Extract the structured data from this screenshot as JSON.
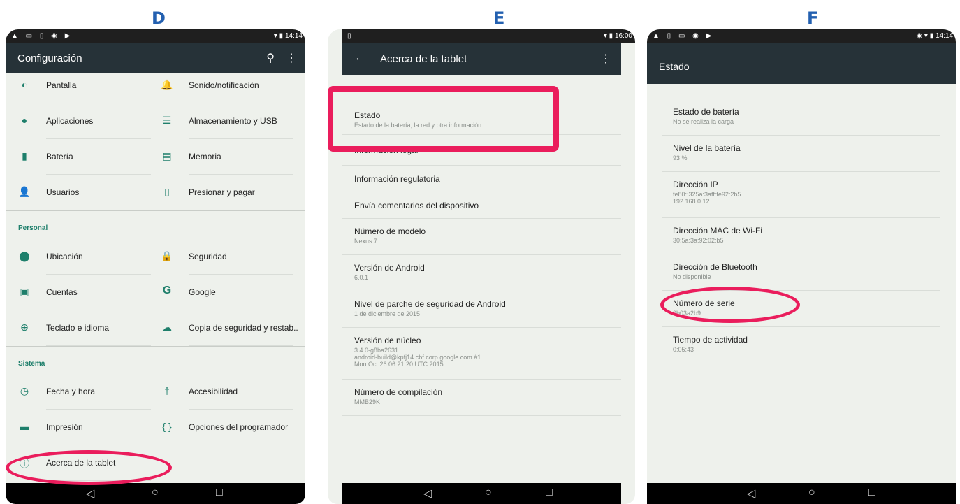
{
  "panels": {
    "d": {
      "letter": "D",
      "status_time": "14:14",
      "title": "Configuración",
      "rows_top": [
        {
          "left": {
            "icon": "brightness-icon",
            "glyph": "◐",
            "label": "Pantalla"
          },
          "right": {
            "icon": "bell-icon",
            "glyph": "🔔",
            "label": "Sonido/notificación"
          }
        },
        {
          "left": {
            "icon": "android-icon",
            "glyph": "●",
            "label": "Aplicaciones"
          },
          "right": {
            "icon": "storage-icon",
            "glyph": "☰",
            "label": "Almacenamiento y USB"
          }
        },
        {
          "left": {
            "icon": "battery-icon",
            "glyph": "▮",
            "label": "Batería"
          },
          "right": {
            "icon": "memory-icon",
            "glyph": "▤",
            "label": "Memoria"
          }
        },
        {
          "left": {
            "icon": "user-icon",
            "glyph": "👤",
            "label": "Usuarios"
          },
          "right": {
            "icon": "tap-pay-icon",
            "glyph": "▯",
            "label": "Presionar y pagar"
          }
        }
      ],
      "section_personal": "Personal",
      "rows_personal": [
        {
          "left": {
            "icon": "location-icon",
            "glyph": "⬤",
            "label": "Ubicación"
          },
          "right": {
            "icon": "lock-icon",
            "glyph": "🔒",
            "label": "Seguridad"
          }
        },
        {
          "left": {
            "icon": "account-icon",
            "glyph": "▣",
            "label": "Cuentas"
          },
          "right": {
            "icon": "google-icon",
            "glyph": "G",
            "label": "Google"
          }
        },
        {
          "left": {
            "icon": "globe-icon",
            "glyph": "⊕",
            "label": "Teclado e idioma"
          },
          "right": {
            "icon": "cloud-upload-icon",
            "glyph": "☁",
            "label": "Copia de seguridad y restab.."
          }
        }
      ],
      "section_system": "Sistema",
      "rows_system": [
        {
          "left": {
            "icon": "clock-icon",
            "glyph": "◷",
            "label": "Fecha y hora"
          },
          "right": {
            "icon": "accessibility-icon",
            "glyph": "†",
            "label": "Accesibilidad"
          }
        },
        {
          "left": {
            "icon": "print-icon",
            "glyph": "▬",
            "label": "Impresión"
          },
          "right": {
            "icon": "code-braces-icon",
            "glyph": "{ }",
            "label": "Opciones del programador"
          }
        },
        {
          "left": {
            "icon": "info-icon",
            "glyph": "ⓘ",
            "label": "Acerca de la tablet"
          }
        }
      ]
    },
    "e": {
      "letter": "E",
      "status_time": "16:00",
      "title": "Acerca de la tablet",
      "items": [
        {
          "title": "Estado",
          "subtitle": "Estado de la batería, la red y otra información"
        },
        {
          "title": "Información legal",
          "subtitle": ""
        },
        {
          "title": "Información regulatoria",
          "subtitle": ""
        },
        {
          "title": "Envía comentarios del dispositivo",
          "subtitle": ""
        },
        {
          "title": "Número de modelo",
          "subtitle": "Nexus 7"
        },
        {
          "title": "Versión de Android",
          "subtitle": "6.0.1"
        },
        {
          "title": "Nivel de parche de seguridad de Android",
          "subtitle": "1 de diciembre de 2015"
        },
        {
          "title": "Versión de núcleo",
          "subtitle": "3.4.0-g8ba2631\nandroid-build@kpfj14.cbf.corp.google.com #1\nMon Oct 26 06:21:20 UTC 2015"
        },
        {
          "title": "Número de compilación",
          "subtitle": "MMB29K"
        }
      ]
    },
    "f": {
      "letter": "F",
      "status_time": "14:14",
      "title": "Estado",
      "items": [
        {
          "title": "Estado de batería",
          "subtitle": "No se realiza la carga"
        },
        {
          "title": "Nivel de la batería",
          "subtitle": "93 %"
        },
        {
          "title": "Dirección IP",
          "subtitle": "fe80::325a:3aff:fe92:2b5\n192.168.0.12"
        },
        {
          "title": "Dirección MAC de Wi-Fi",
          "subtitle": "30:5a:3a:92:02:b5"
        },
        {
          "title": "Dirección de Bluetooth",
          "subtitle": "No disponible"
        },
        {
          "title": "Número de serie",
          "subtitle": "0b03a2b9"
        },
        {
          "title": "Tiempo de actividad",
          "subtitle": "0:05:43"
        }
      ]
    }
  },
  "nav": {
    "back": "◁",
    "home": "○",
    "recents": "□"
  },
  "colors": {
    "toolbar": "#263238",
    "accent": "#1e7f6b",
    "highlight": "#ea1d5c",
    "letter": "#2360b0"
  }
}
